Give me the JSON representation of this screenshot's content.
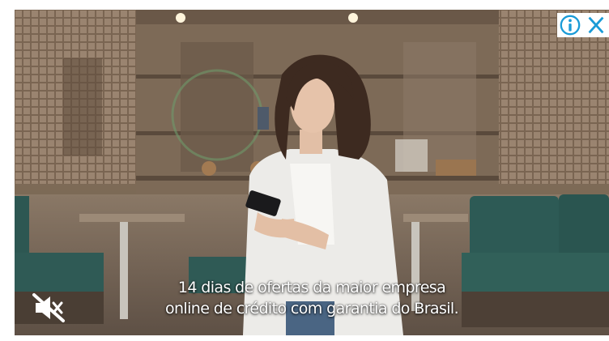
{
  "ad": {
    "caption_line1": "14 dias de ofertas da maior empresa",
    "caption_line2": "online de crédito com garantia do Brasil.",
    "icons": {
      "info": "info-icon",
      "close": "close-icon",
      "mute": "muted-speaker-icon"
    },
    "colors": {
      "adchoices_blue": "#1a9bd7",
      "caption_text": "#ffffff",
      "sofa_teal": "#2f5a55"
    }
  }
}
